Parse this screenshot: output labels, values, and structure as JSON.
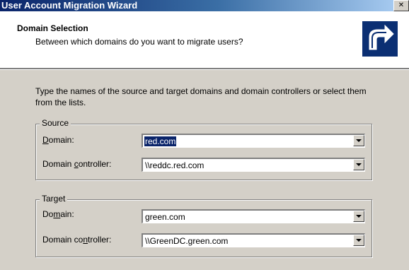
{
  "window": {
    "title": "User Account Migration Wizard",
    "close_glyph": "✕"
  },
  "header": {
    "title": "Domain Selection",
    "subtitle": "Between which domains do you want to migrate users?",
    "icon": "wizard-arrow-icon"
  },
  "instructions": "Type the names of the source and target domains and domain controllers or select them from the lists.",
  "source": {
    "legend": "Source",
    "domain_label_hot": "D",
    "domain_label_rest": "omain:",
    "domain_value": "red.com",
    "dc_label_pre": "Domain ",
    "dc_label_hot": "c",
    "dc_label_rest": "ontroller:",
    "dc_value": "\\\\reddc.red.com"
  },
  "target": {
    "legend": "Target",
    "domain_label_pre": "Do",
    "domain_label_hot": "m",
    "domain_label_rest": "ain:",
    "domain_value": "green.com",
    "dc_label_pre": "Domain co",
    "dc_label_hot": "n",
    "dc_label_rest": "troller:",
    "dc_value": "\\\\GreenDC.green.com"
  },
  "colors": {
    "title_bar": "#0a246a",
    "dialog_face": "#d4d0c8",
    "selection": "#0a246a",
    "icon_bg": "#0b2f73"
  }
}
